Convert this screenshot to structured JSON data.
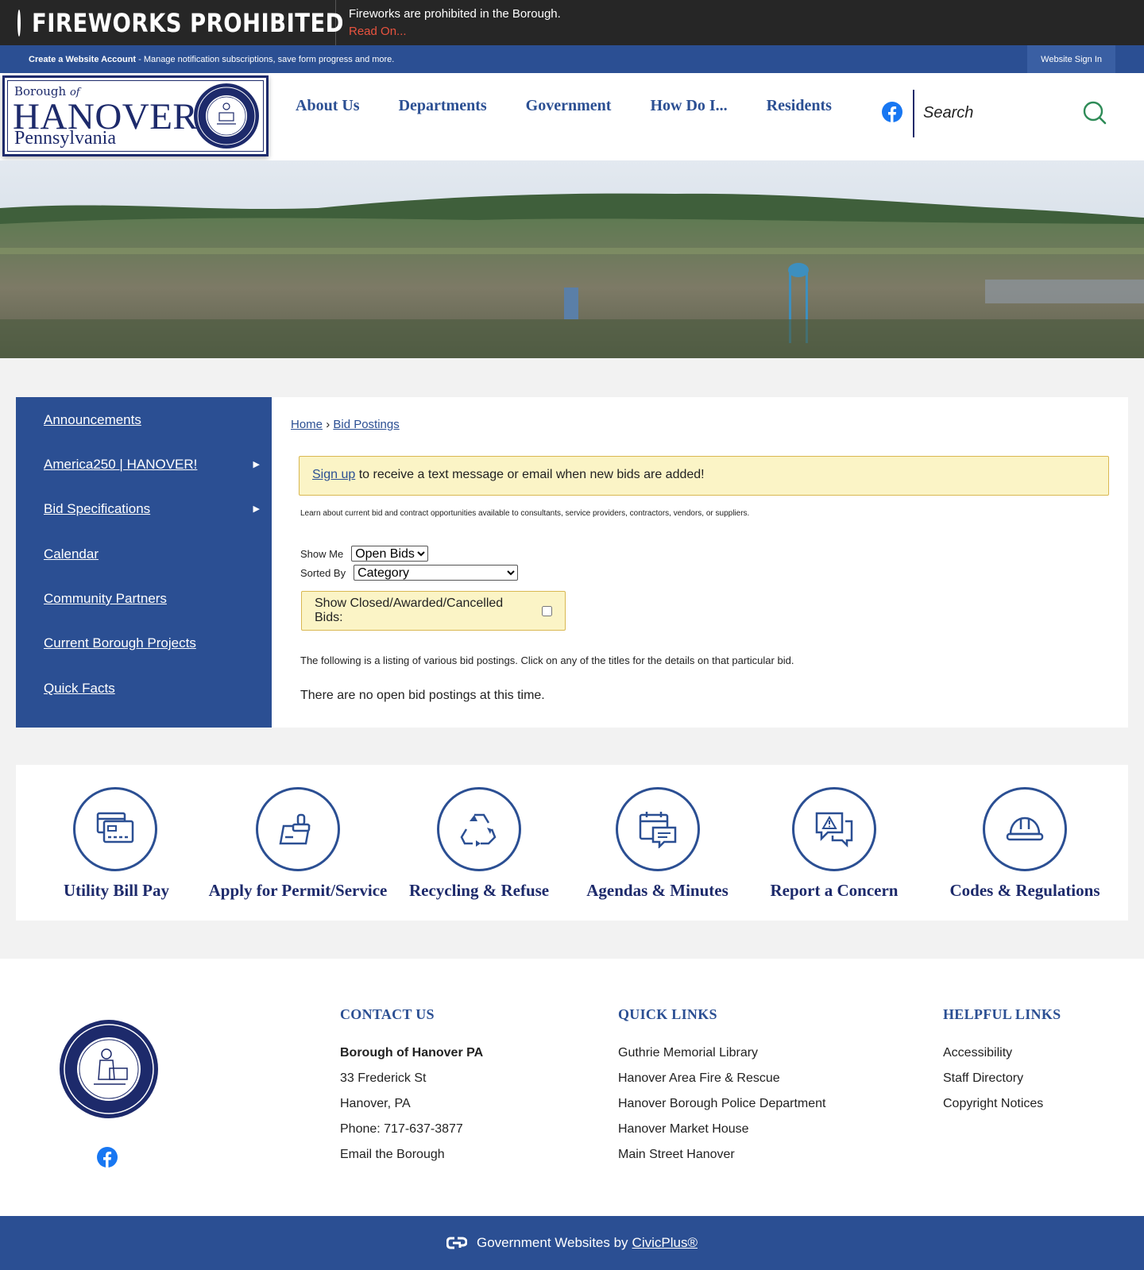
{
  "alert": {
    "title": "FIREWORKS PROHIBITED",
    "message": "Fireworks are prohibited in the Borough.",
    "link": "Read On..."
  },
  "account_bar": {
    "bold_text": "Create a Website Account",
    "text": " - Manage notification subscriptions, save form progress and more.",
    "signin": "Website Sign In"
  },
  "logo": {
    "borough": "Borough",
    "of": "of",
    "name": "HANOVER",
    "state": "Pennsylvania"
  },
  "nav": [
    "About Us",
    "Departments",
    "Government",
    "How Do I...",
    "Residents"
  ],
  "search": {
    "placeholder": "Search"
  },
  "sidebar": {
    "items": [
      {
        "label": "Announcements",
        "has_arrow": false
      },
      {
        "label": "America250 | HANOVER!",
        "has_arrow": true
      },
      {
        "label": "Bid Specifications",
        "has_arrow": true
      },
      {
        "label": "Calendar",
        "has_arrow": false
      },
      {
        "label": "Community Partners",
        "has_arrow": false
      },
      {
        "label": "Current Borough Projects",
        "has_arrow": false
      },
      {
        "label": "Quick Facts",
        "has_arrow": false
      }
    ]
  },
  "breadcrumb": {
    "home": "Home",
    "separator": "›",
    "current": "Bid Postings"
  },
  "notice": {
    "link": "Sign up",
    "text": " to receive a text message or email when new bids are added!"
  },
  "intro": "Learn about current bid and contract opportunities available to consultants, service providers, contractors, vendors, or suppliers.",
  "filters": {
    "show_label": "Show Me",
    "show_value": "Open Bids",
    "sort_label": "Sorted By",
    "sort_value": "Category",
    "closed_label": "Show Closed/Awarded/Cancelled Bids:"
  },
  "listing_text": "The following is a listing of various bid postings. Click on any of the titles for the details on that particular bid.",
  "no_bids": "There are no open bid postings at this time.",
  "quick_links": [
    {
      "label": "Utility Bill Pay",
      "icon": "bill-pay-icon"
    },
    {
      "label": "Apply for Permit/Service",
      "icon": "permit-stamp-icon"
    },
    {
      "label": "Recycling & Refuse",
      "icon": "recycle-icon"
    },
    {
      "label": "Agendas & Minutes",
      "icon": "calendar-agenda-icon"
    },
    {
      "label": "Report a Concern",
      "icon": "report-concern-icon"
    },
    {
      "label": "Codes & Regulations",
      "icon": "hard-hat-icon"
    }
  ],
  "footer": {
    "contact": {
      "heading": "CONTACT US",
      "name": "Borough of Hanover PA",
      "address1": "33 Frederick St",
      "address2": "Hanover, PA",
      "phone": "Phone: 717-637-3877",
      "email": "Email the Borough"
    },
    "quick_links": {
      "heading": "QUICK LINKS",
      "items": [
        "Guthrie Memorial Library",
        "Hanover Area Fire & Rescue",
        "Hanover Borough Police Department",
        "Hanover Market House",
        "Main Street Hanover"
      ]
    },
    "helpful_links": {
      "heading": "HELPFUL LINKS",
      "items": [
        "Accessibility",
        "Staff Directory",
        "Copyright Notices"
      ]
    }
  },
  "bottom_bar": {
    "text": "Government Websites by",
    "link": "CivicPlus®"
  },
  "colors": {
    "primary_blue": "#2b4f93",
    "navy": "#1d2a6b",
    "alert_bg": "#262626",
    "alert_link": "#e9533f",
    "notice_bg": "#fbf4c6"
  }
}
